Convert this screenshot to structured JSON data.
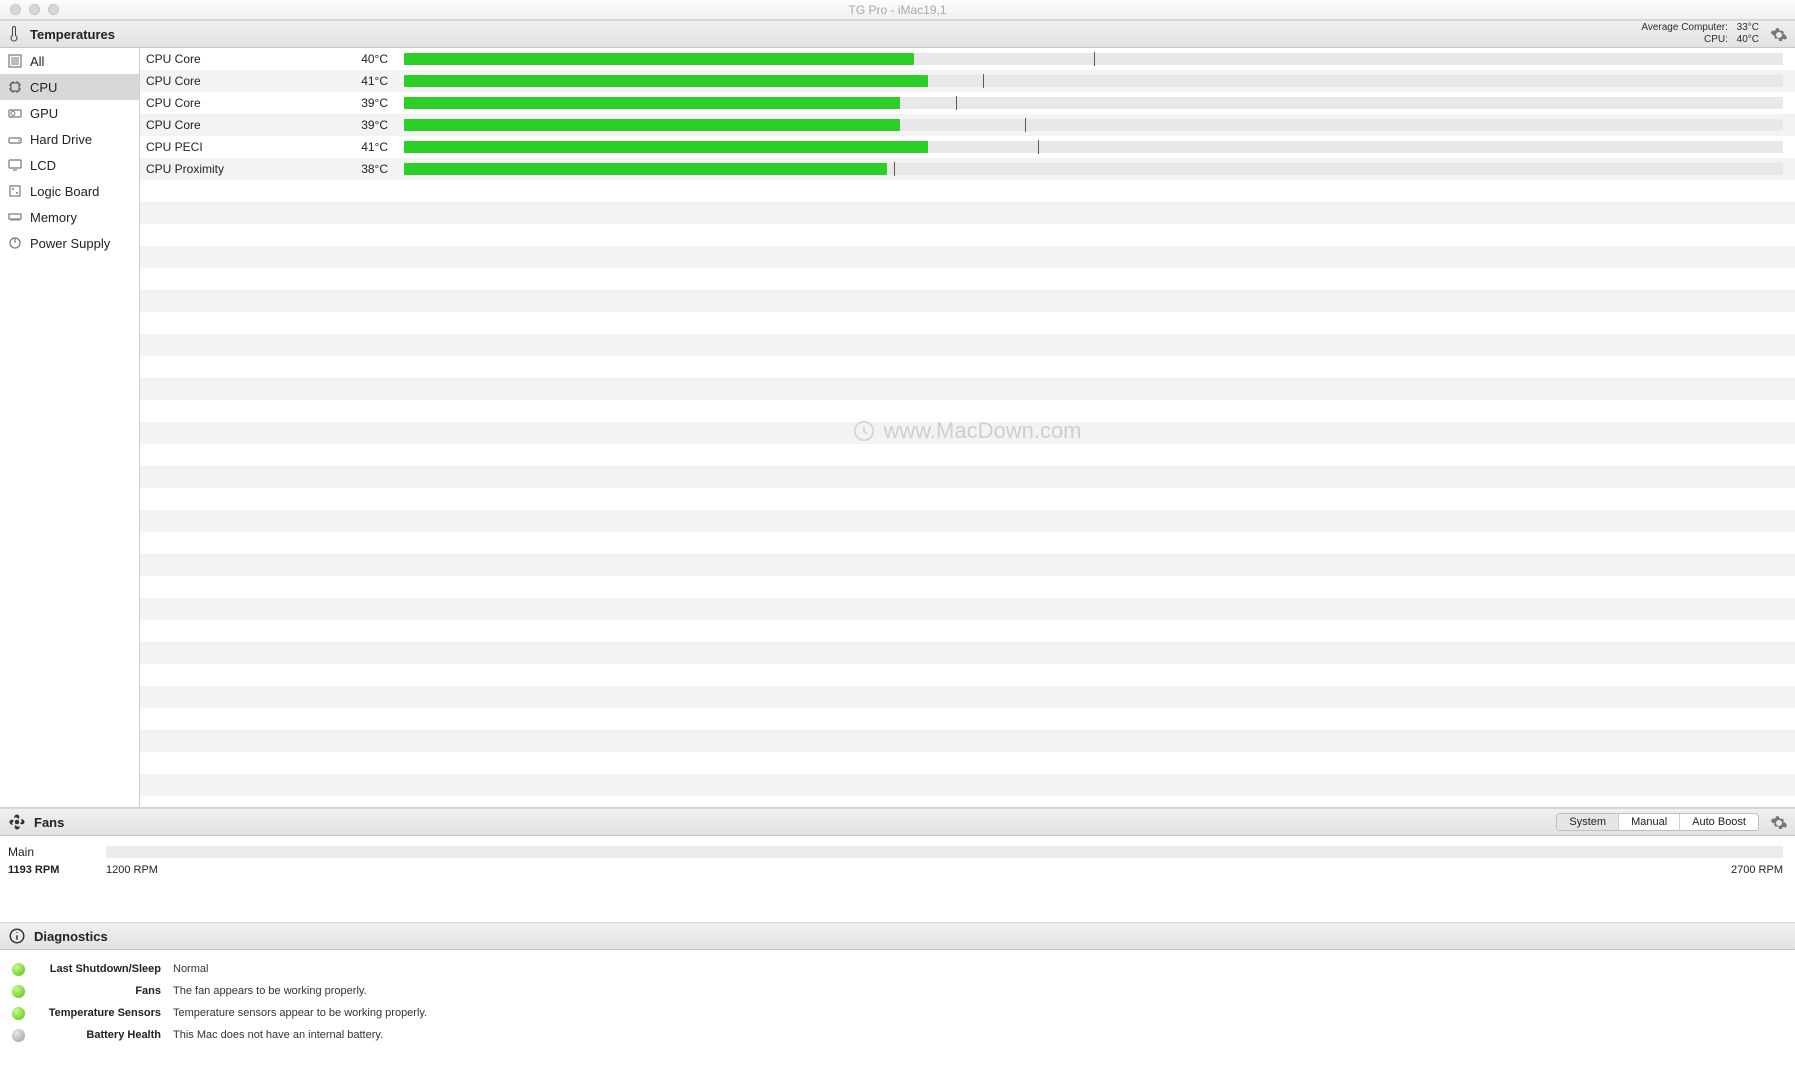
{
  "window": {
    "title": "TG Pro - iMac19,1"
  },
  "temperatures": {
    "title": "Temperatures",
    "avg_label": "Average Computer:",
    "avg_value": "33°C",
    "cpu_label": "CPU:",
    "cpu_value": "40°C"
  },
  "sidebar": {
    "items": [
      {
        "label": "All"
      },
      {
        "label": "CPU"
      },
      {
        "label": "GPU"
      },
      {
        "label": "Hard Drive"
      },
      {
        "label": "LCD"
      },
      {
        "label": "Logic Board"
      },
      {
        "label": "Memory"
      },
      {
        "label": "Power Supply"
      }
    ]
  },
  "sensors": [
    {
      "name": "CPU Core",
      "value": "40°C",
      "fill": 37,
      "tick": 50
    },
    {
      "name": "CPU Core",
      "value": "41°C",
      "fill": 38,
      "tick": 42
    },
    {
      "name": "CPU Core",
      "value": "39°C",
      "fill": 36,
      "tick": 40
    },
    {
      "name": "CPU Core",
      "value": "39°C",
      "fill": 36,
      "tick": 45
    },
    {
      "name": "CPU PECI",
      "value": "41°C",
      "fill": 38,
      "tick": 46
    },
    {
      "name": "CPU Proximity",
      "value": "38°C",
      "fill": 35,
      "tick": 35.5
    }
  ],
  "watermark": "www.MacDown.com",
  "fans": {
    "title": "Fans",
    "modes": [
      "System",
      "Manual",
      "Auto Boost"
    ],
    "active_mode": 0,
    "item": {
      "name": "Main",
      "current": "1193 RPM",
      "min": "1200 RPM",
      "max": "2700 RPM"
    }
  },
  "diagnostics": {
    "title": "Diagnostics",
    "rows": [
      {
        "status": "green",
        "label": "Last Shutdown/Sleep",
        "value": "Normal"
      },
      {
        "status": "green",
        "label": "Fans",
        "value": "The fan appears to be working properly."
      },
      {
        "status": "green",
        "label": "Temperature Sensors",
        "value": "Temperature sensors appear to be working properly."
      },
      {
        "status": "gray",
        "label": "Battery Health",
        "value": "This Mac does not have an internal battery."
      }
    ]
  }
}
